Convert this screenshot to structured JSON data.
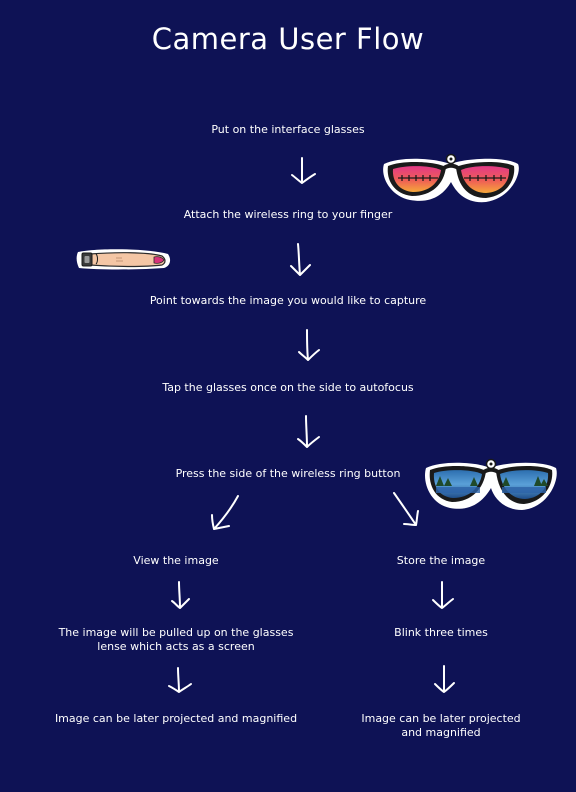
{
  "title": "Camera User Flow",
  "steps": {
    "s1": "Put on the interface glasses",
    "s2": "Attach the wireless ring to your finger",
    "s3": "Point towards the image you would like to capture",
    "s4": "Tap the glasses once on the side to autofocus",
    "s5": "Press the side of the wireless ring button"
  },
  "left_branch": {
    "s1": "View the image",
    "s2_line1": "The image will be pulled up on the glasses",
    "s2_line2": "lense which acts as a screen",
    "s3": "Image can be later projected and magnified"
  },
  "right_branch": {
    "s1": "Store the image",
    "s2": "Blink three times",
    "s3_line1": "Image can be later projected",
    "s3_line2": "and magnified"
  },
  "colors": {
    "background": "#0e1255",
    "text": "#ffffff",
    "lens_top": "#e8307a",
    "lens_bottom": "#f5a23a"
  },
  "icons": [
    "sunglasses-icon",
    "finger-ring-icon",
    "landscape-glasses-icon",
    "down-arrow-icon"
  ]
}
